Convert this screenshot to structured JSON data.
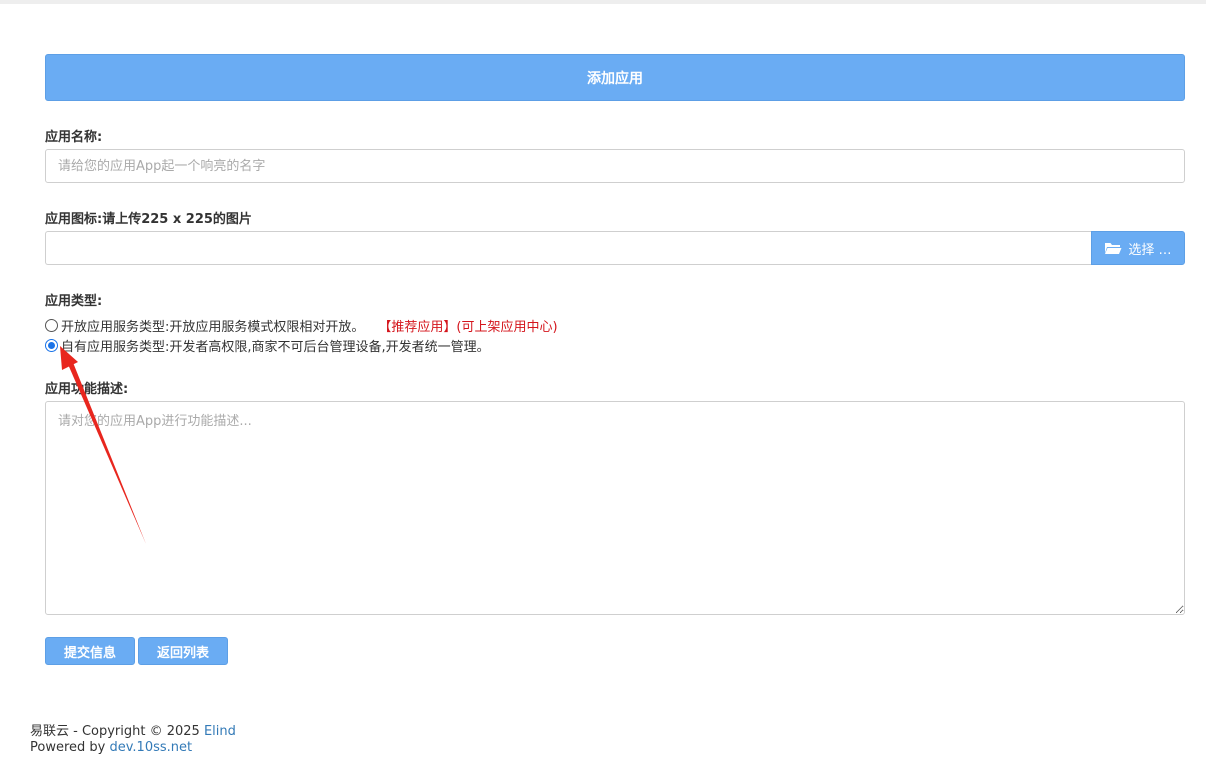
{
  "header": {
    "title": "添加应用"
  },
  "form": {
    "name_label": "应用名称:",
    "name_placeholder": "请给您的应用App起一个响亮的名字",
    "icon_label": "应用图标:请上传225 x 225的图片",
    "icon_button": "选择 …",
    "type_label": "应用类型:",
    "type_options": [
      {
        "text": "开放应用服务类型:开放应用服务模式权限相对开放。",
        "note": "【推荐应用】(可上架应用中心)",
        "checked": false
      },
      {
        "text": "自有应用服务类型:开发者高权限,商家不可后台管理设备,开发者统一管理。",
        "note": "",
        "checked": true
      }
    ],
    "desc_label": "应用功能描述:",
    "desc_placeholder": "请对您的应用App进行功能描述..."
  },
  "buttons": {
    "submit": "提交信息",
    "back": "返回列表"
  },
  "footer": {
    "copyright_prefix": "易联云 - Copyright © 2025 ",
    "copyright_link": "Elind",
    "powered_prefix": "Powered by ",
    "powered_link": "dev.10ss.net"
  },
  "colors": {
    "accent": "#6aacf3",
    "recommend": "#d4141b",
    "annotation_arrow": "#e8261e"
  }
}
